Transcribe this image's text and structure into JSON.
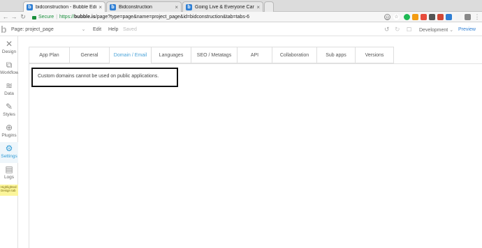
{
  "browser": {
    "tabs": [
      {
        "title": "bidconstruction - Bubble Edito",
        "close": "×",
        "favicon": "b"
      },
      {
        "title": "Bidconstruction",
        "close": "×",
        "favicon": "b"
      },
      {
        "title": "Going Live & Everyone Can Edi",
        "close": "×",
        "favicon": "b"
      }
    ],
    "secure_label": "Secure",
    "url_prefix": "https://",
    "url_host": "bubble.is",
    "url_path": "/page?type=page&name=project_page&id=bidconstruction&tab=tabs-6"
  },
  "editor": {
    "page_label": "Page: project_page",
    "menu": {
      "edit": "Edit",
      "help": "Help",
      "saved": "Saved"
    },
    "environment": "Development",
    "preview": "Preview"
  },
  "sidebar": {
    "items": [
      {
        "label": "Design",
        "icon": "design-icon"
      },
      {
        "label": "Workflow",
        "icon": "workflow-icon"
      },
      {
        "label": "Data",
        "icon": "data-icon"
      },
      {
        "label": "Styles",
        "icon": "styles-icon"
      },
      {
        "label": "Plugins",
        "icon": "plugins-icon"
      },
      {
        "label": "Settings",
        "icon": "gear-icon"
      },
      {
        "label": "Logs",
        "icon": "logs-icon"
      }
    ],
    "tip": "Highlighted: Design tab"
  },
  "settings": {
    "tabs": [
      "App Plan",
      "General",
      "Domain / Email",
      "Languages",
      "SEO / Metatags",
      "API",
      "Collaboration",
      "Sub apps",
      "Versions"
    ],
    "active_tab": "Domain / Email",
    "notice": "Custom domains cannot be used on public applications."
  },
  "colors": {
    "accent": "#4aa3d8",
    "secure": "#1a8f3c"
  }
}
